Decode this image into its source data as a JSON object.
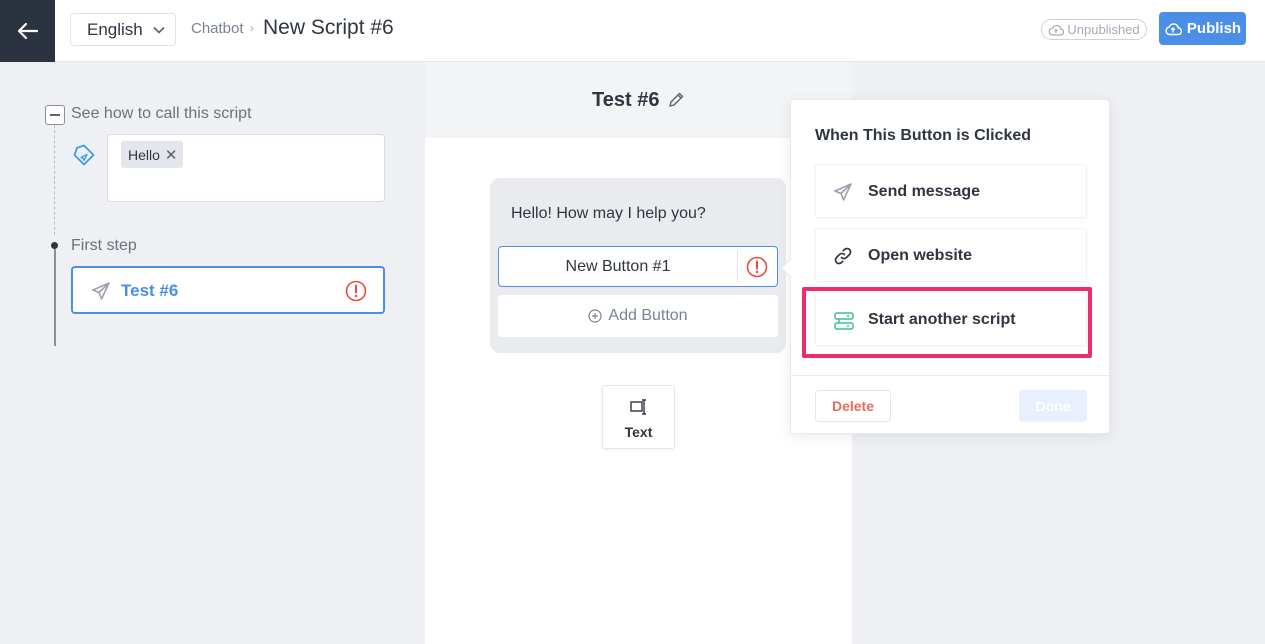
{
  "header": {
    "language": "English",
    "breadcrumb": "Chatbot",
    "title": "New Script #6",
    "status": "Unpublished",
    "publish_label": "Publish"
  },
  "sidebar": {
    "call_label": "See how to call this script",
    "keywords": [
      "Hello"
    ],
    "first_step_label": "First step",
    "step_name": "Test #6"
  },
  "canvas": {
    "title": "Test #6",
    "message": "Hello! How may I help you?",
    "button_label": "New Button #1",
    "add_button_label": "Add Button",
    "tool_label": "Text"
  },
  "popover": {
    "title": "When This Button is Clicked",
    "options": [
      {
        "label": "Send message",
        "icon": "send-icon"
      },
      {
        "label": "Open website",
        "icon": "link-icon"
      },
      {
        "label": "Start another script",
        "icon": "script-icon"
      }
    ],
    "delete_label": "Delete",
    "done_label": "Done"
  },
  "colors": {
    "accent": "#4a8ee8",
    "warning": "#e74c3c",
    "highlight": "#f02d6b",
    "script_icon": "#3cbf9a"
  }
}
